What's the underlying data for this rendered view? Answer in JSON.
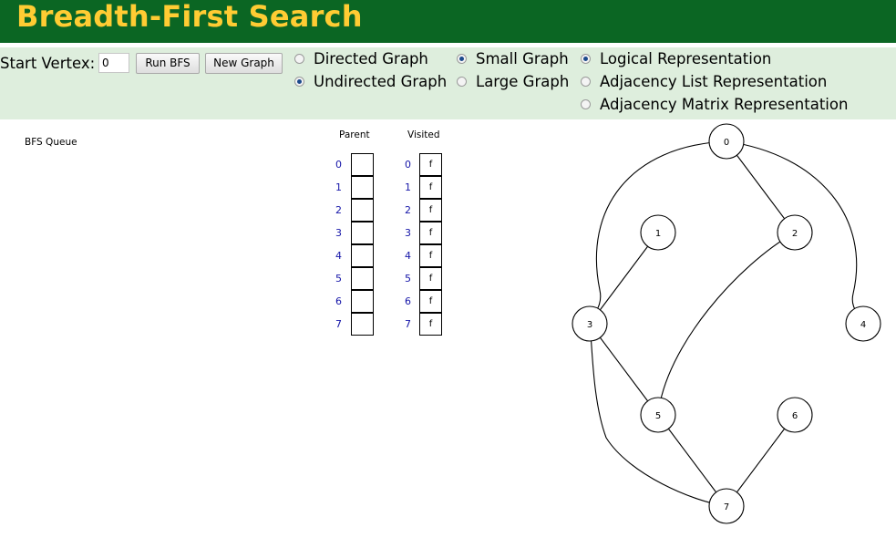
{
  "header": {
    "title": "Breadth-First Search"
  },
  "controls": {
    "start_vertex_label": "Start Vertex:",
    "start_vertex_value": "0",
    "run_bfs_label": "Run BFS",
    "new_graph_label": "New Graph",
    "directed_label": "Directed Graph",
    "directed_selected": false,
    "undirected_label": "Undirected Graph",
    "undirected_selected": true,
    "small_graph_label": "Small Graph",
    "small_graph_selected": true,
    "large_graph_label": "Large Graph",
    "large_graph_selected": false,
    "logical_label": "Logical Representation",
    "logical_selected": true,
    "adj_list_label": "Adjacency List Representation",
    "adj_list_selected": false,
    "adj_matrix_label": "Adjacency Matrix Representation",
    "adj_matrix_selected": false
  },
  "bfs_queue_label": "BFS Queue",
  "parent_label": "Parent",
  "visited_label": "Visited",
  "indices": [
    "0",
    "1",
    "2",
    "3",
    "4",
    "5",
    "6",
    "7"
  ],
  "parent_values": [
    "",
    "",
    "",
    "",
    "",
    "",
    "",
    ""
  ],
  "visited_values": [
    "f",
    "f",
    "f",
    "f",
    "f",
    "f",
    "f",
    "f"
  ],
  "graph": {
    "nodes": [
      "0",
      "1",
      "2",
      "3",
      "4",
      "5",
      "6",
      "7"
    ],
    "edges": [
      [
        "0",
        "2"
      ],
      [
        "0",
        "3"
      ],
      [
        "0",
        "4"
      ],
      [
        "1",
        "3"
      ],
      [
        "2",
        "5"
      ],
      [
        "3",
        "5"
      ],
      [
        "3",
        "7"
      ],
      [
        "5",
        "7"
      ],
      [
        "6",
        "7"
      ]
    ]
  }
}
